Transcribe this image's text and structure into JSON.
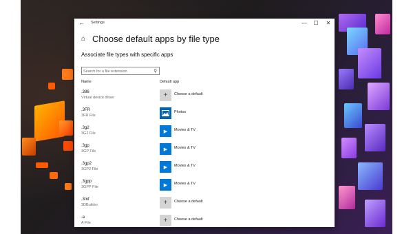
{
  "window": {
    "title": "Settings",
    "minimize": "—",
    "maximize": "☐",
    "close": "✕"
  },
  "page": {
    "title": "Choose default apps by file type",
    "section_heading": "Associate file types with specific apps"
  },
  "search": {
    "placeholder": "Search for a file extension",
    "value": ""
  },
  "columns": {
    "name": "Name",
    "default_app": "Default app"
  },
  "rows": [
    {
      "ext": ".386",
      "desc": "Virtual device driver",
      "app": "Choose a default",
      "icon": "plus-icon"
    },
    {
      "ext": ".3FR",
      "desc": "3FR File",
      "app": "Photos",
      "icon": "photos-icon"
    },
    {
      "ext": ".3g2",
      "desc": "3G2 File",
      "app": "Movies & TV",
      "icon": "play-icon"
    },
    {
      "ext": ".3gp",
      "desc": "3GP File",
      "app": "Movies & TV",
      "icon": "play-icon"
    },
    {
      "ext": ".3gp2",
      "desc": "3GP2 File",
      "app": "Movies & TV",
      "icon": "play-icon"
    },
    {
      "ext": ".3gpp",
      "desc": "3GPP File",
      "app": "Movies & TV",
      "icon": "play-icon"
    },
    {
      "ext": ".3mf",
      "desc": "3DBuilder",
      "app": "Choose a default",
      "icon": "plus-icon"
    },
    {
      "ext": ".a",
      "desc": "A File",
      "app": "Choose a default",
      "icon": "plus-icon"
    }
  ],
  "colors": {
    "accent": "#0078d7",
    "photos_tile": "#0063b1",
    "plus_tile": "#d4d4d4"
  }
}
